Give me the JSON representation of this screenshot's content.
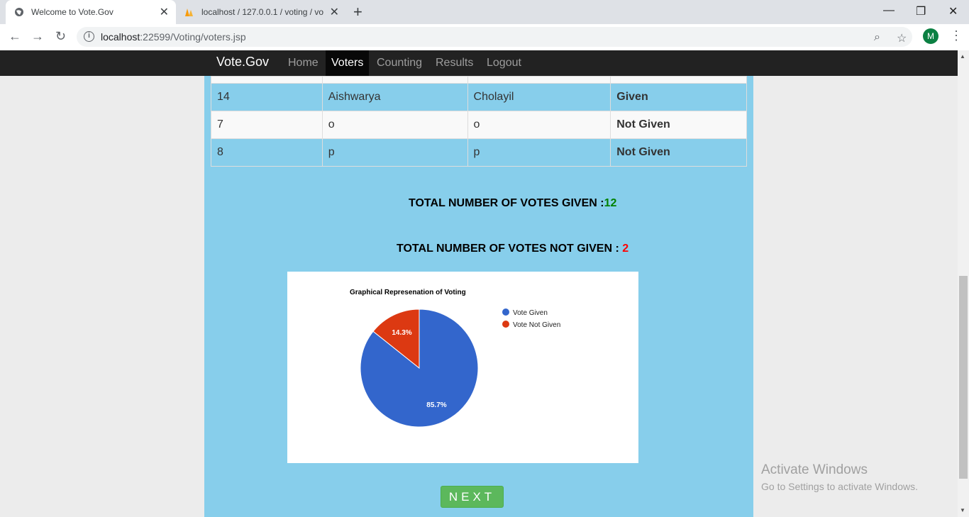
{
  "browser": {
    "tabs": [
      {
        "title": "Welcome to Vote.Gov",
        "active": true
      },
      {
        "title": "localhost / 127.0.0.1 / voting / vo",
        "active": false
      }
    ],
    "url_host": "localhost",
    "url_rest": ":22599/Voting/voters.jsp",
    "avatar_letter": "M"
  },
  "navbar": {
    "brand": "Vote.Gov",
    "links": [
      "Home",
      "Voters",
      "Counting",
      "Results",
      "Logout"
    ],
    "active_link": "Voters"
  },
  "voters_table": {
    "rows": [
      {
        "id": "14",
        "first": "Aishwarya",
        "last": "Cholayil",
        "status": "Given"
      },
      {
        "id": "7",
        "first": "o",
        "last": "o",
        "status": "Not Given"
      },
      {
        "id": "8",
        "first": "p",
        "last": "p",
        "status": "Not Given"
      }
    ]
  },
  "totals": {
    "given_label": "TOTAL NUMBER OF VOTES GIVEN :",
    "given_value": "12",
    "not_given_label": "TOTAL NUMBER OF VOTES NOT GIVEN :",
    "not_given_value": "2"
  },
  "chart_data": {
    "type": "pie",
    "title": "Graphical Represenation of Voting",
    "categories": [
      "Vote Given",
      "Vote Not Given"
    ],
    "values": [
      12,
      2
    ],
    "labels": [
      "85.7%",
      "14.3%"
    ],
    "colors": [
      "#3366cc",
      "#dc3912"
    ],
    "legend": "right"
  },
  "next_button": "NEXT",
  "watermark": {
    "line1": "Activate Windows",
    "line2": "Go to Settings to activate Windows."
  }
}
